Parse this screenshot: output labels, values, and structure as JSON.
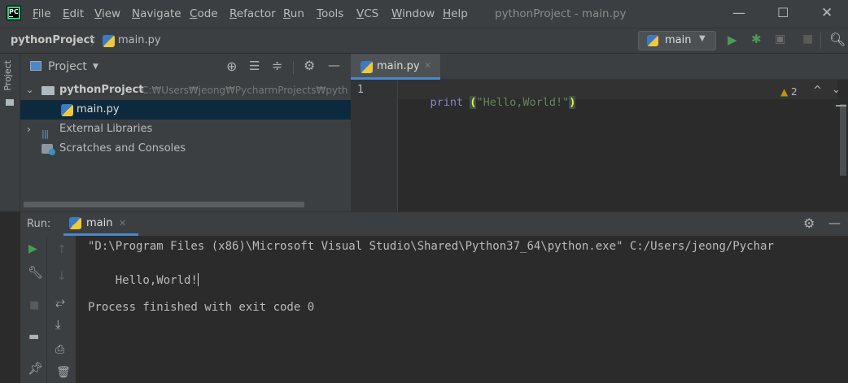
{
  "menubar": {
    "items": [
      "File",
      "Edit",
      "View",
      "Navigate",
      "Code",
      "Refactor",
      "Run",
      "Tools",
      "VCS",
      "Window",
      "Help"
    ],
    "window_title": "pythonProject - main.py"
  },
  "navbar": {
    "project": "pythonProject",
    "file": "main.py",
    "run_config": "main"
  },
  "sidebar": {
    "tab_label": "Project"
  },
  "project_pane": {
    "header": "Project",
    "root_name": "pythonProject",
    "root_path": "C:₩Users₩jeong₩PycharmProjects₩pyth",
    "file": "main.py",
    "external_libraries": "External Libraries",
    "scratches": "Scratches and Consoles"
  },
  "editor": {
    "tab": "main.py",
    "line_number": "1",
    "code_func": "print",
    "code_paren_open": "(",
    "code_string": "\"Hello,World!\"",
    "code_paren_close": ")",
    "warnings_count": "2"
  },
  "run": {
    "label": "Run:",
    "tab": "main",
    "console_lines": [
      "\"D:\\Program Files (x86)\\Microsoft Visual Studio\\Shared\\Python37_64\\python.exe\" C:/Users/jeong/Pychar",
      "Hello,World!",
      "",
      "Process finished with exit code 0"
    ]
  },
  "colors": {
    "accent_green": "#499c54",
    "keyword_purple": "#b200b2",
    "string_green": "#6a8759",
    "selection": "#0d293e",
    "warning_yellow": "#be9117"
  }
}
